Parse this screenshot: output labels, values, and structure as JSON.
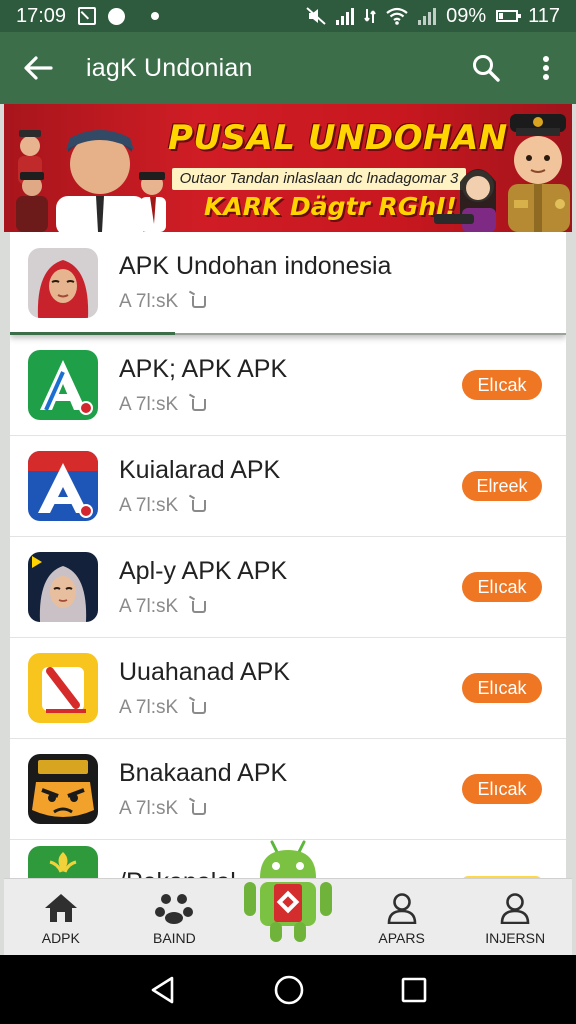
{
  "status_bar": {
    "time": "17:09",
    "battery_percent": "09%",
    "right_number": "117"
  },
  "app_bar": {
    "title": "iagK Undonian",
    "back_icon": "arrow-left-icon",
    "search_icon": "search-icon",
    "menu_icon": "more-vert-icon"
  },
  "banner": {
    "headline": "PUSAL UNDOHAN",
    "subtitle": "Outaor Tandan inlaslaan dc lnadagomar 3",
    "slogan": "KARK Dägtr RGhI!"
  },
  "list": {
    "highlighted": {
      "name": "APK Undohan indonesia",
      "meta": "A 7l:sK"
    },
    "items": [
      {
        "name": "APK; APK APK",
        "meta": "A 7l:sK",
        "button": "Elıcak",
        "icon": "green-a-logo-icon"
      },
      {
        "name": "Kuialarad APK",
        "meta": "A 7l:sK",
        "button": "Elreek",
        "icon": "blue-red-a-logo-icon"
      },
      {
        "name": "Apl-y APK APK",
        "meta": "A 7l:sK",
        "button": "Elıcak",
        "icon": "hijab-portrait-icon"
      },
      {
        "name": "Uuahanad APK",
        "meta": "A 7l:sK",
        "button": "Elıcak",
        "icon": "yellow-slash-logo-icon"
      },
      {
        "name": "Bnakaand APK",
        "meta": "A 7l:sK",
        "button": "Elıcak",
        "icon": "angry-face-logo-icon"
      }
    ],
    "partial_item": {
      "name": "/Pekanalal"
    }
  },
  "bottom_nav": {
    "items": [
      {
        "label": "ADPK",
        "icon": "home-icon"
      },
      {
        "label": "BAIND",
        "icon": "group-icon"
      },
      {
        "label": "",
        "icon": "android-robot-icon"
      },
      {
        "label": "APARS",
        "icon": "person-icon"
      },
      {
        "label": "INJERSN",
        "icon": "person-icon"
      }
    ]
  },
  "colors": {
    "status_bar": "#2e5a3d",
    "app_bar": "#3d6e4a",
    "banner_red": "#d01d25",
    "banner_yellow": "#ffd400",
    "button_orange": "#ef7623"
  }
}
